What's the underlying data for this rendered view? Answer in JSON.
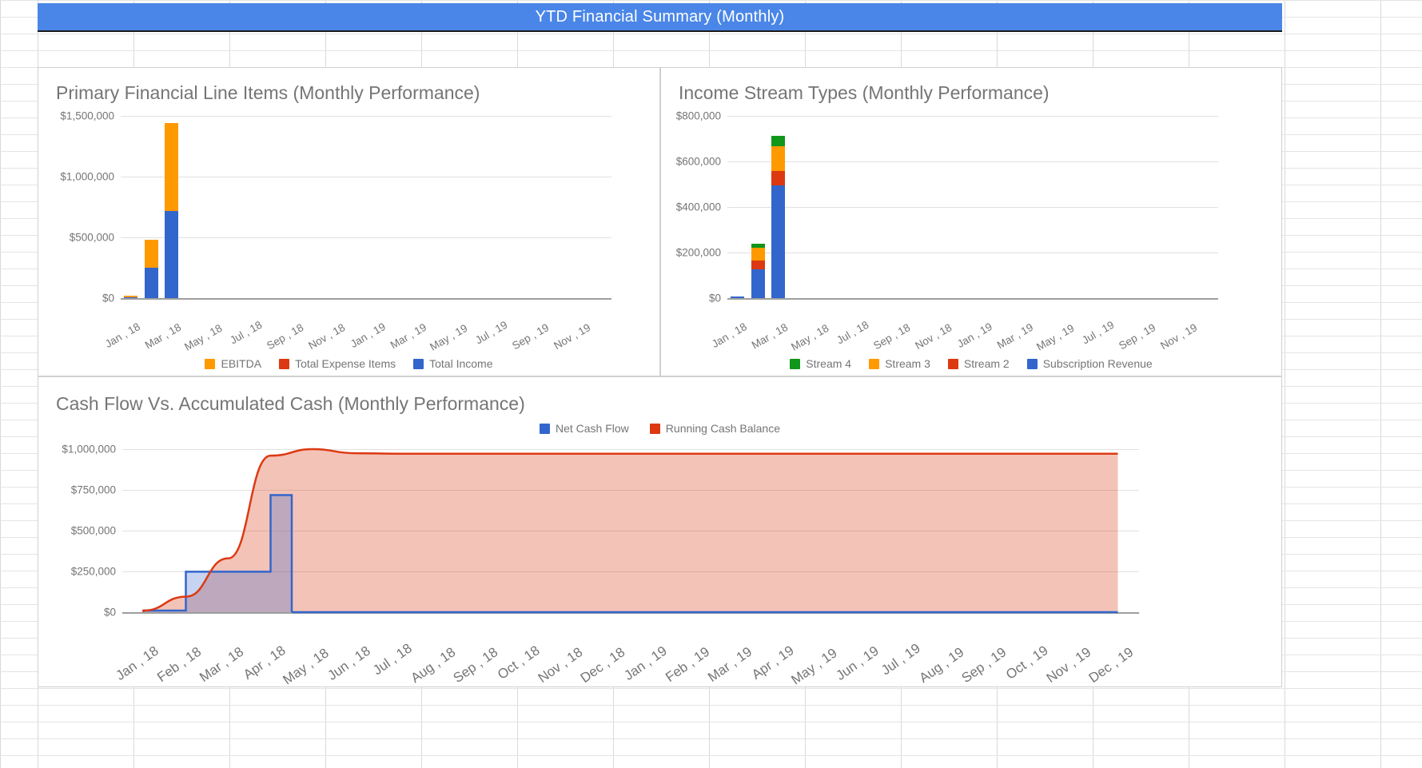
{
  "dashboard": {
    "title": "YTD Financial Summary (Monthly)",
    "title_bar_color": "#4a86e8"
  },
  "panels": [
    {
      "id": "primary-line-items",
      "title": "Primary Financial Line Items (Monthly Performance)"
    },
    {
      "id": "income-stream-types",
      "title": "Income Stream Types (Monthly Performance)"
    },
    {
      "id": "cash-flow-vs-accumulated",
      "title": "Cash Flow Vs. Accumulated Cash (Monthly Performance)"
    }
  ],
  "colors": {
    "blue": "#3366cc",
    "orange": "#ff9900",
    "red": "#dc3912",
    "green": "#109618",
    "grid": "#e0e0e0",
    "axis": "#9e9e9e",
    "text": "#757575"
  },
  "chart_data": [
    {
      "type": "bar",
      "id": "primary-line-items",
      "title": "Primary Financial Line Items (Monthly Performance)",
      "stacked": true,
      "xlabel": "",
      "ylabel": "",
      "ylim": [
        0,
        1500000
      ],
      "yticks": [
        0,
        500000,
        1000000,
        1500000
      ],
      "ytick_labels": [
        "$0",
        "$500,000",
        "$1,000,000",
        "$1,500,000"
      ],
      "grid": true,
      "legend_position": "bottom",
      "categories": [
        "Jan , 18",
        "Feb , 18",
        "Mar , 18",
        "Apr , 18",
        "May , 18",
        "Jun , 18",
        "Jul , 18",
        "Aug , 18",
        "Sep , 18",
        "Oct , 18",
        "Nov , 18",
        "Dec , 18",
        "Jan , 19",
        "Feb , 19",
        "Mar , 19",
        "Apr , 19",
        "May , 19",
        "Jun , 19",
        "Jul , 19",
        "Aug , 19",
        "Sep , 19",
        "Oct , 19",
        "Nov , 19",
        "Dec , 19"
      ],
      "xtick_labels": [
        "Jan , 18",
        "Mar , 18",
        "May , 18",
        "Jul , 18",
        "Sep , 18",
        "Nov , 18",
        "Jan , 19",
        "Mar , 19",
        "May , 19",
        "Jul , 19",
        "Sep , 19",
        "Nov , 19"
      ],
      "series": [
        {
          "name": "Total Income",
          "color": "#3366cc",
          "values": [
            8000,
            250000,
            720000,
            0,
            0,
            0,
            0,
            0,
            0,
            0,
            0,
            0,
            0,
            0,
            0,
            0,
            0,
            0,
            0,
            0,
            0,
            0,
            0,
            0
          ]
        },
        {
          "name": "Total Expense Items",
          "color": "#dc3912",
          "values": [
            0,
            0,
            0,
            0,
            0,
            0,
            0,
            0,
            0,
            0,
            0,
            0,
            0,
            0,
            0,
            0,
            0,
            0,
            0,
            0,
            0,
            0,
            0,
            0
          ]
        },
        {
          "name": "EBITDA",
          "color": "#ff9900",
          "values": [
            9000,
            230000,
            720000,
            0,
            0,
            0,
            0,
            0,
            0,
            0,
            0,
            0,
            0,
            0,
            0,
            0,
            0,
            0,
            0,
            0,
            0,
            0,
            0,
            0
          ]
        }
      ],
      "legend": [
        "EBITDA",
        "Total Expense Items",
        "Total Income"
      ]
    },
    {
      "type": "bar",
      "id": "income-stream-types",
      "title": "Income Stream Types (Monthly Performance)",
      "stacked": true,
      "xlabel": "",
      "ylabel": "",
      "ylim": [
        0,
        800000
      ],
      "yticks": [
        0,
        200000,
        400000,
        600000,
        800000
      ],
      "ytick_labels": [
        "$0",
        "$200,000",
        "$400,000",
        "$600,000",
        "$800,000"
      ],
      "grid": true,
      "legend_position": "bottom",
      "categories": [
        "Jan , 18",
        "Feb , 18",
        "Mar , 18",
        "Apr , 18",
        "May , 18",
        "Jun , 18",
        "Jul , 18",
        "Aug , 18",
        "Sep , 18",
        "Oct , 18",
        "Nov , 18",
        "Dec , 18",
        "Jan , 19",
        "Feb , 19",
        "Mar , 19",
        "Apr , 19",
        "May , 19",
        "Jun , 19",
        "Jul , 19",
        "Aug , 19",
        "Sep , 19",
        "Oct , 19",
        "Nov , 19",
        "Dec , 19"
      ],
      "xtick_labels": [
        "Jan , 18",
        "Mar , 18",
        "May , 18",
        "Jul , 18",
        "Sep , 18",
        "Nov , 18",
        "Jan , 19",
        "Mar , 19",
        "May , 19",
        "Jul , 19",
        "Sep , 19",
        "Nov , 19"
      ],
      "series": [
        {
          "name": "Subscription Revenue",
          "color": "#3366cc",
          "values": [
            6000,
            125000,
            495000,
            0,
            0,
            0,
            0,
            0,
            0,
            0,
            0,
            0,
            0,
            0,
            0,
            0,
            0,
            0,
            0,
            0,
            0,
            0,
            0,
            0
          ]
        },
        {
          "name": "Stream 2",
          "color": "#dc3912",
          "values": [
            0,
            40000,
            63000,
            0,
            0,
            0,
            0,
            0,
            0,
            0,
            0,
            0,
            0,
            0,
            0,
            0,
            0,
            0,
            0,
            0,
            0,
            0,
            0,
            0
          ]
        },
        {
          "name": "Stream 3",
          "color": "#ff9900",
          "values": [
            0,
            56000,
            110000,
            0,
            0,
            0,
            0,
            0,
            0,
            0,
            0,
            0,
            0,
            0,
            0,
            0,
            0,
            0,
            0,
            0,
            0,
            0,
            0,
            0
          ]
        },
        {
          "name": "Stream 4",
          "color": "#109618",
          "values": [
            0,
            16000,
            45000,
            0,
            0,
            0,
            0,
            0,
            0,
            0,
            0,
            0,
            0,
            0,
            0,
            0,
            0,
            0,
            0,
            0,
            0,
            0,
            0,
            0
          ]
        }
      ],
      "legend": [
        "Stream 4",
        "Stream 3",
        "Stream 2",
        "Subscription Revenue"
      ]
    },
    {
      "type": "area",
      "id": "cash-flow-vs-accumulated",
      "title": "Cash Flow Vs. Accumulated Cash (Monthly Performance)",
      "xlabel": "",
      "ylabel": "",
      "ylim": [
        0,
        1000000
      ],
      "yticks": [
        0,
        250000,
        500000,
        750000,
        1000000
      ],
      "ytick_labels": [
        "$0",
        "$250,000",
        "$500,000",
        "$750,000",
        "$1,000,000"
      ],
      "grid": true,
      "legend_position": "top",
      "categories": [
        "Jan , 18",
        "Feb , 18",
        "Mar , 18",
        "Apr , 18",
        "May , 18",
        "Jun , 18",
        "Jul , 18",
        "Aug , 18",
        "Sep , 18",
        "Oct , 18",
        "Nov , 18",
        "Dec , 18",
        "Jan , 19",
        "Feb , 19",
        "Mar , 19",
        "Apr , 19",
        "May , 19",
        "Jun , 19",
        "Jul , 19",
        "Aug , 19",
        "Sep , 19",
        "Oct , 19",
        "Nov , 19",
        "Dec , 19"
      ],
      "xtick_labels": [
        "Jan , 18",
        "Feb , 18",
        "Mar , 18",
        "Apr , 18",
        "May , 18",
        "Jun , 18",
        "Jul , 18",
        "Aug , 18",
        "Sep , 18",
        "Oct , 18",
        "Nov , 18",
        "Dec , 18",
        "Jan , 19",
        "Feb , 19",
        "Mar , 19",
        "Apr , 19",
        "May , 19",
        "Jun , 19",
        "Jul , 19",
        "Aug , 19",
        "Sep , 19",
        "Oct , 19",
        "Nov , 19",
        "Dec , 19"
      ],
      "series": [
        {
          "name": "Net Cash Flow",
          "color": "#3366cc",
          "values": [
            10000,
            248000,
            248000,
            718000,
            0,
            0,
            0,
            0,
            0,
            0,
            0,
            0,
            0,
            0,
            0,
            0,
            0,
            0,
            0,
            0,
            0,
            0,
            0,
            0
          ]
        },
        {
          "name": "Running Cash Balance",
          "color": "#dc3912",
          "values": [
            10000,
            95000,
            330000,
            960000,
            1000000,
            975000,
            972000,
            972000,
            972000,
            972000,
            972000,
            972000,
            972000,
            972000,
            972000,
            972000,
            972000,
            972000,
            972000,
            972000,
            972000,
            972000,
            972000,
            972000
          ]
        }
      ],
      "legend": [
        "Net Cash Flow",
        "Running Cash Balance"
      ]
    }
  ]
}
